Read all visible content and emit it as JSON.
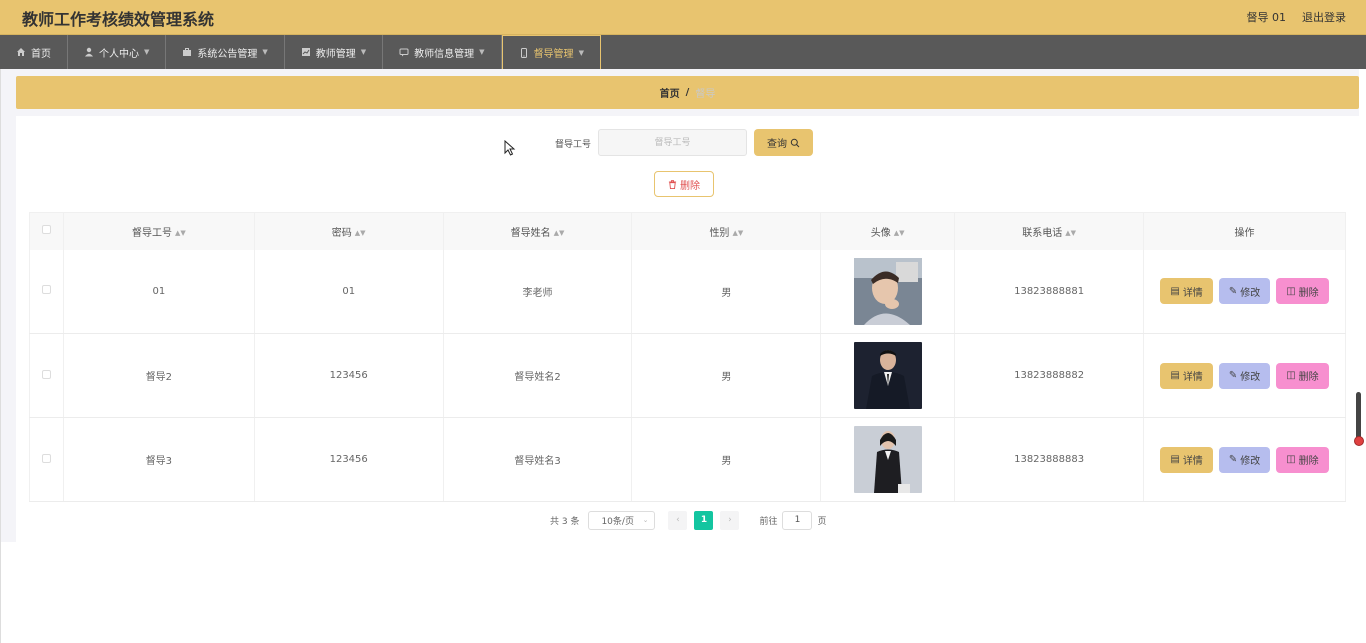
{
  "header": {
    "title": "教师工作考核绩效管理系统",
    "user": "督导 01",
    "logout": "退出登录"
  },
  "nav": [
    {
      "label": "首页",
      "icon": "home-icon"
    },
    {
      "label": "个人中心",
      "icon": "user-icon"
    },
    {
      "label": "系统公告管理",
      "icon": "briefcase-icon"
    },
    {
      "label": "教师管理",
      "icon": "chart-icon"
    },
    {
      "label": "教师信息管理",
      "icon": "message-icon"
    },
    {
      "label": "督导管理",
      "icon": "phone-icon"
    }
  ],
  "breadcrumb": {
    "home": "首页",
    "sep": "/",
    "current": "督导"
  },
  "search": {
    "label": "督导工号",
    "placeholder": "督导工号",
    "query_label": "查询"
  },
  "batch_delete_label": "删除",
  "table": {
    "columns": [
      "督导工号",
      "密码",
      "督导姓名",
      "性别",
      "头像",
      "联系电话",
      "操作"
    ],
    "rows": [
      {
        "id": "01",
        "password": "01",
        "name": "李老师",
        "gender": "男",
        "phone": "13823888881"
      },
      {
        "id": "督导2",
        "password": "123456",
        "name": "督导姓名2",
        "gender": "男",
        "phone": "13823888882"
      },
      {
        "id": "督导3",
        "password": "123456",
        "name": "督导姓名3",
        "gender": "男",
        "phone": "13823888883"
      }
    ],
    "actions": {
      "detail": "详情",
      "edit": "修改",
      "delete": "删除"
    }
  },
  "pagination": {
    "total": "共 3 条",
    "page_size": "10条/页",
    "current_page": "1",
    "goto_label": "前往",
    "goto_value": "1",
    "page_unit": "页"
  },
  "colors": {
    "accent": "#e8c46f",
    "nav_bg": "#595959",
    "edit": "#b6bdee",
    "delete": "#f78fcf",
    "page_active": "#13c5a0"
  }
}
